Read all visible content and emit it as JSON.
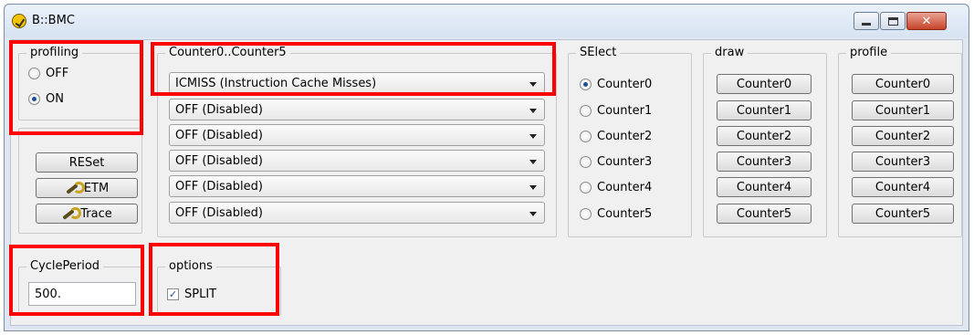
{
  "window": {
    "title": "B::BMC",
    "controls": {
      "minimize": "minimize",
      "maximize": "maximize",
      "close": "✕"
    }
  },
  "profiling": {
    "legend": "profiling",
    "options": [
      {
        "label": "OFF",
        "selected": false
      },
      {
        "label": "ON",
        "selected": true
      }
    ]
  },
  "actions": {
    "reset_label": "RESet",
    "etm_label": "ETM",
    "trace_label": "Trace"
  },
  "counters": {
    "legend": "Counter0..Counter5",
    "values": [
      "ICMISS (Instruction Cache Misses)",
      "OFF (Disabled)",
      "OFF (Disabled)",
      "OFF (Disabled)",
      "OFF (Disabled)",
      "OFF (Disabled)"
    ]
  },
  "select": {
    "legend": "SElect",
    "options": [
      {
        "label": "Counter0",
        "selected": true
      },
      {
        "label": "Counter1",
        "selected": false
      },
      {
        "label": "Counter2",
        "selected": false
      },
      {
        "label": "Counter3",
        "selected": false
      },
      {
        "label": "Counter4",
        "selected": false
      },
      {
        "label": "Counter5",
        "selected": false
      }
    ]
  },
  "draw": {
    "legend": "draw",
    "buttons": [
      "Counter0",
      "Counter1",
      "Counter2",
      "Counter3",
      "Counter4",
      "Counter5"
    ]
  },
  "profile": {
    "legend": "profile",
    "buttons": [
      "Counter0",
      "Counter1",
      "Counter2",
      "Counter3",
      "Counter4",
      "Counter5"
    ]
  },
  "cycle_period": {
    "legend": "CyclePeriod",
    "value": "500."
  },
  "options": {
    "legend": "options",
    "split_label": "SPLIT",
    "split_checked": true
  },
  "colors": {
    "highlight": "#ff0000",
    "window_frame": "#dfe6f0",
    "client_bg": "#f0f0f0"
  }
}
